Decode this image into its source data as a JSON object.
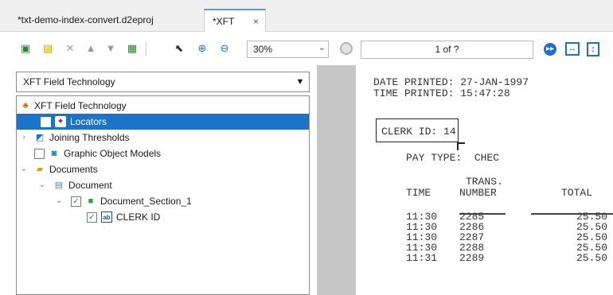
{
  "tabs": [
    {
      "label": "*txt-demo-index-convert.d2eproj"
    },
    {
      "label": "*XFT",
      "close": "×"
    }
  ],
  "toolbar": {
    "zoom_value": "30%",
    "page_indicator": "1 of ?"
  },
  "left": {
    "combo_value": "XFT Field Technology",
    "tree": [
      {
        "label": "XFT Field Technology"
      },
      {
        "label": "Locators"
      },
      {
        "label": "Joining Thresholds"
      },
      {
        "label": "Graphic Object Models"
      },
      {
        "label": "Documents"
      },
      {
        "label": "Document"
      },
      {
        "label": "Document_Section_1"
      },
      {
        "label": "CLERK ID"
      }
    ]
  },
  "document": {
    "lines": {
      "date": "DATE PRINTED: 27-JAN-1997",
      "time": "TIME PRINTED: 15:47:28",
      "clerk": "CLERK ID: 14",
      "paytype": "PAY TYPE:  CHEC",
      "hdr1": "TRANS.",
      "hdr_time": "TIME",
      "hdr_number": "NUMBER",
      "hdr_total": "TOTAL"
    },
    "rows": [
      {
        "time": "11:30",
        "number": "2285",
        "total": "25.50"
      },
      {
        "time": "11:30",
        "number": "2286",
        "total": "25.50"
      },
      {
        "time": "11:30",
        "number": "2287",
        "total": "25.50"
      },
      {
        "time": "11:30",
        "number": "2288",
        "total": "25.50"
      },
      {
        "time": "11:31",
        "number": "2289",
        "total": "25.50"
      }
    ]
  },
  "colors": {
    "selection": "#1b74c8",
    "accent": "#1e6fd0",
    "splitter": "#c6c6c6"
  }
}
